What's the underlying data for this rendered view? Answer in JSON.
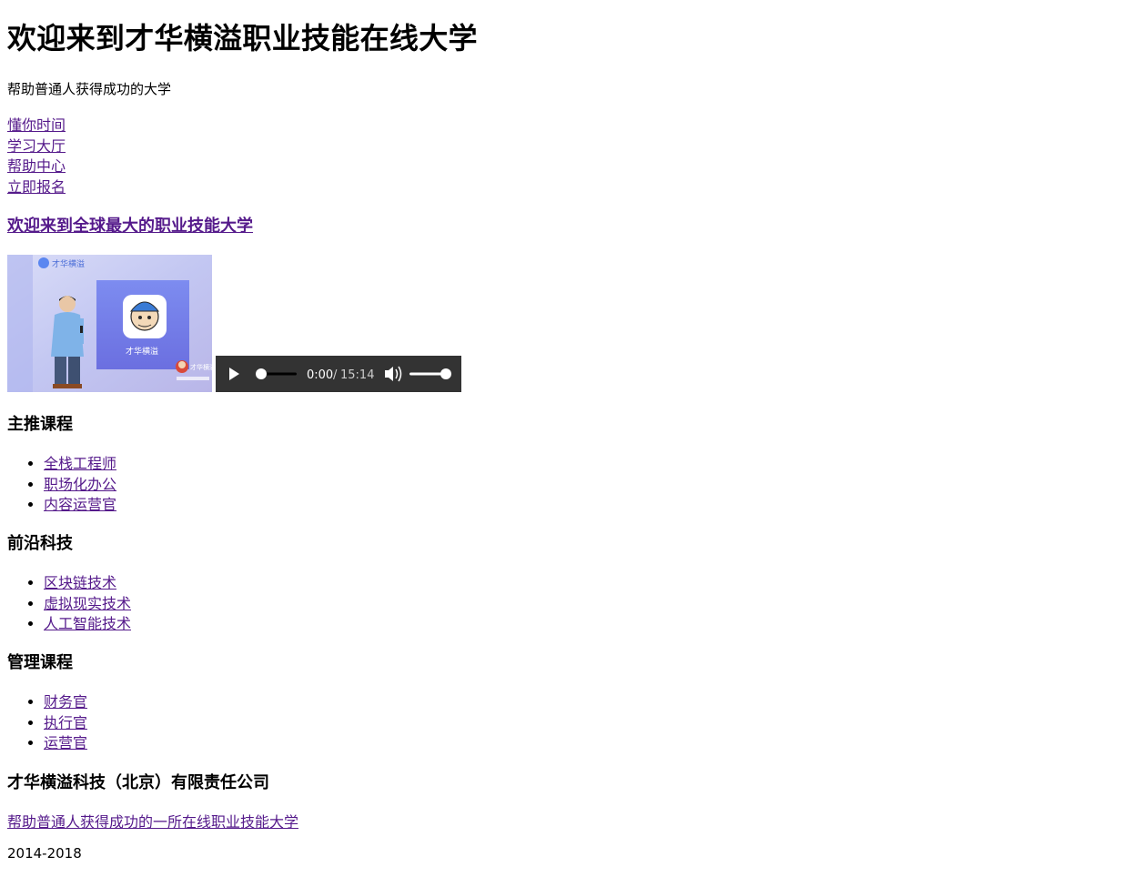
{
  "header": {
    "title": "欢迎来到才华横溢职业技能在线大学",
    "subtitle": "帮助普通人获得成功的大学"
  },
  "nav": [
    {
      "label": "懂你时间"
    },
    {
      "label": "学习大厅"
    },
    {
      "label": "帮助中心"
    },
    {
      "label": "立即报名"
    }
  ],
  "main": {
    "welcome_link": "欢迎来到全球最大的职业技能大学",
    "video": {
      "logo_text": "才华横溢",
      "app_label": "才华横溢",
      "corner_text": "才华横溢"
    },
    "audio": {
      "current_time": "0:00",
      "separator": "/",
      "duration": "15:14",
      "progress": 0,
      "volume": 1.0
    }
  },
  "sections": [
    {
      "title": "主推课程",
      "items": [
        "全栈工程师",
        "职场化办公",
        "内容运营官"
      ]
    },
    {
      "title": "前沿科技",
      "items": [
        "区块链技术",
        "虚拟现实技术",
        "人工智能技术"
      ]
    },
    {
      "title": "管理课程",
      "items": [
        "财务官",
        "执行官",
        "运营官"
      ]
    }
  ],
  "footer": {
    "company": "才华横溢科技（北京）有限责任公司",
    "link": "帮助普通人获得成功的一所在线职业技能大学",
    "copyright": "2014-2018"
  },
  "colors": {
    "link": "#551a8b",
    "audio_bg": "#333333",
    "video_bg": "#c7cdf2",
    "video_accent": "#6a7be6"
  }
}
